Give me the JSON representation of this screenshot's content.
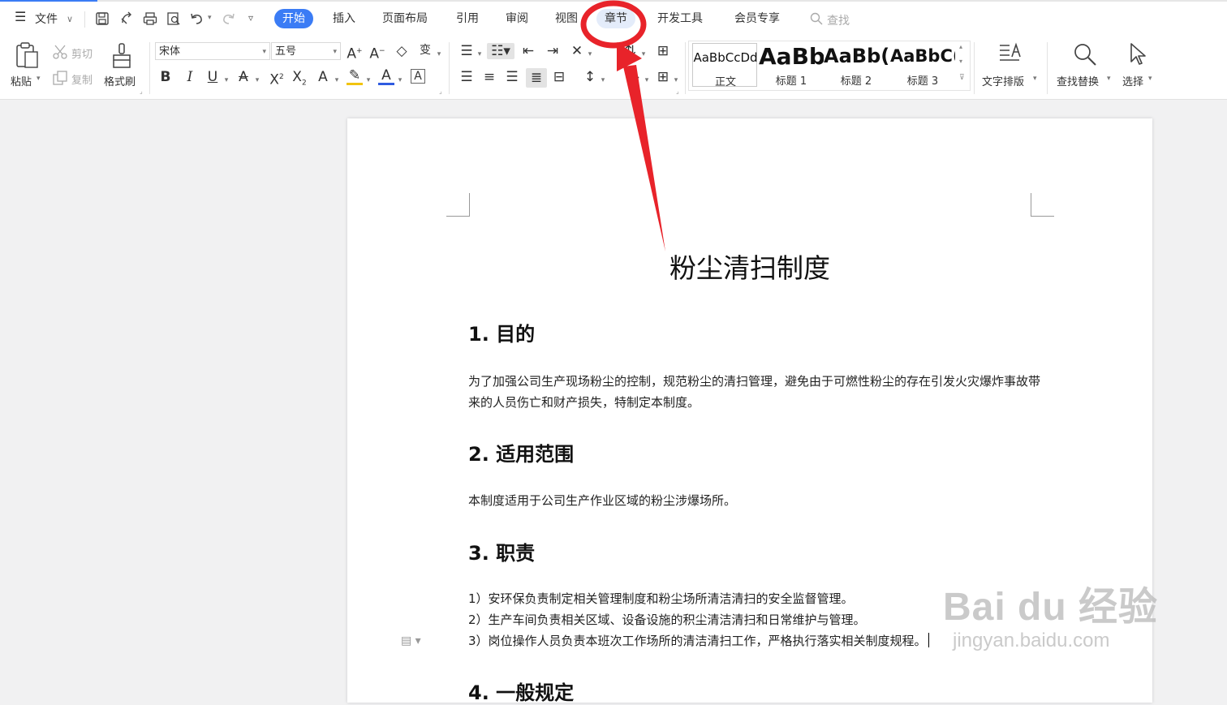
{
  "menu": {
    "file": "文件",
    "tabs": [
      "开始",
      "插入",
      "页面布局",
      "引用",
      "审阅",
      "视图",
      "章节",
      "开发工具",
      "会员专享"
    ],
    "search_placeholder": "查找"
  },
  "ribbon": {
    "paste": "粘贴",
    "cut": "剪切",
    "copy": "复制",
    "format_painter": "格式刷",
    "font_name": "宋体",
    "font_size": "五号",
    "styles": [
      {
        "preview": "AaBbCcDd",
        "name": "正文"
      },
      {
        "preview": "AaBb",
        "name": "标题 1"
      },
      {
        "preview": "AaBb(",
        "name": "标题 2"
      },
      {
        "preview": "AaBbC(",
        "name": "标题 3"
      }
    ],
    "text_layout": "文字排版",
    "find_replace": "查找替换",
    "select": "选择"
  },
  "document": {
    "title": "粉尘清扫制度",
    "sections": [
      {
        "heading": "1. 目的",
        "paragraphs": [
          "为了加强公司生产现场粉尘的控制，规范粉尘的清扫管理，避免由于可燃性粉尘的存在引发火灾爆炸事故带来的人员伤亡和财产损失，特制定本制度。"
        ]
      },
      {
        "heading": "2. 适用范围",
        "paragraphs": [
          "本制度适用于公司生产作业区域的粉尘涉爆场所。"
        ]
      },
      {
        "heading": "3. 职责",
        "paragraphs": [
          "1）安环保负责制定相关管理制度和粉尘场所清洁清扫的安全监督管理。",
          "2）生产车间负责相关区域、设备设施的积尘清洁清扫和日常维护与管理。",
          "3）岗位操作人员负责本班次工作场所的清洁清扫工作，严格执行落实相关制度规程。"
        ]
      },
      {
        "heading": "4. 一般规定"
      }
    ]
  },
  "annotation": {
    "color": "#e8232a"
  },
  "watermark": {
    "main": "Bai  du 经验",
    "url": "jingyan.baidu.com"
  }
}
